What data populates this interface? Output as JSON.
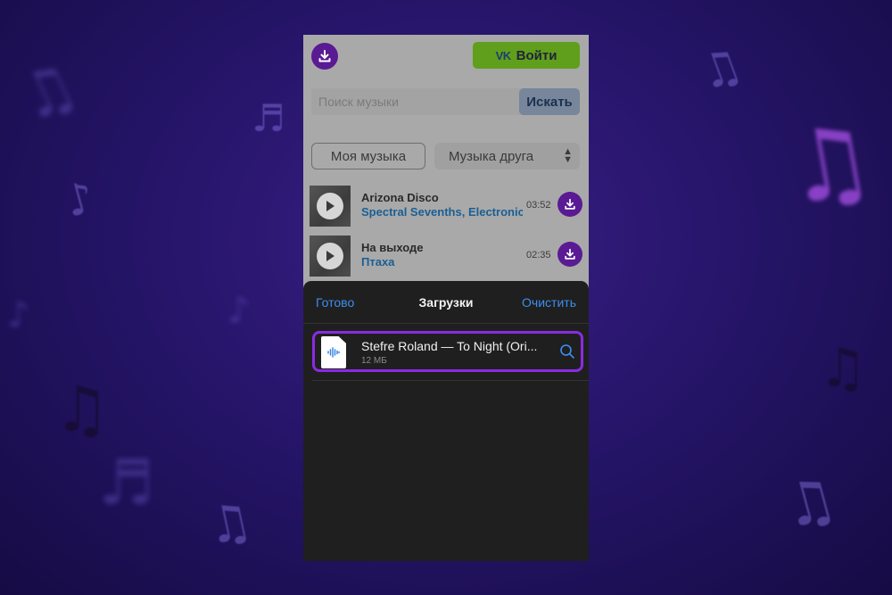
{
  "header": {
    "download_icon": "download-icon",
    "login_label": "Войти",
    "vk_logo_text": "VK"
  },
  "search": {
    "placeholder": "Поиск музыки",
    "button_label": "Искать"
  },
  "tabs": {
    "my_music": "Моя музыка",
    "friend_music": "Музыка друга"
  },
  "tracks": [
    {
      "title": "Arizona Disco",
      "artist": "Spectral Sevenths, Electronic",
      "duration": "03:52"
    },
    {
      "title": "На выходе",
      "artist": "Птаха",
      "duration": "02:35"
    }
  ],
  "downloads_sheet": {
    "done_label": "Готово",
    "title": "Загрузки",
    "clear_label": "Очистить",
    "items": [
      {
        "name": "Stefre Roland — To Night (Ori...",
        "size": "12 МБ"
      }
    ]
  },
  "colors": {
    "accent_purple": "#5a1a93",
    "login_green": "#5f9f1c",
    "link_blue": "#3d8ef0",
    "highlight_border": "#8a2be2",
    "artist_blue": "#1a5f94"
  }
}
